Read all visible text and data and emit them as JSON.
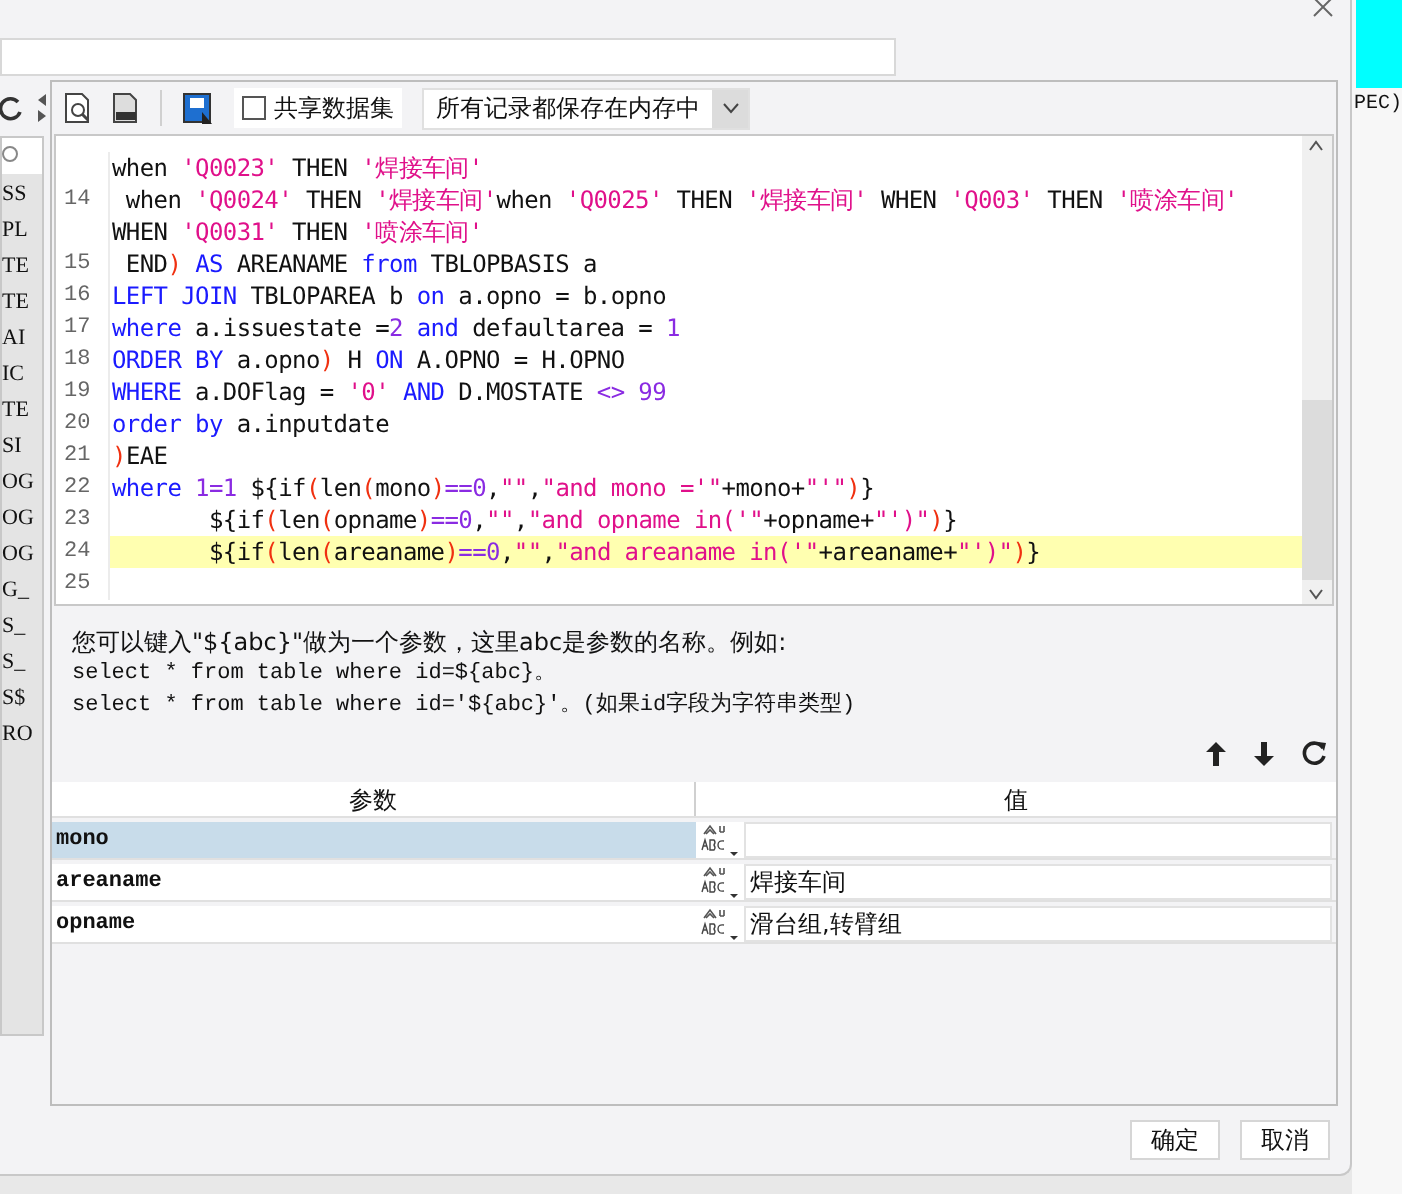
{
  "toolbar": {
    "share_checkbox": {
      "label": "共享数据集",
      "checked": false
    },
    "cache_dropdown": {
      "value": "所有记录都保存在内存中"
    }
  },
  "side_list": [
    "SS",
    "PL",
    "TE",
    "TE",
    "AI",
    "IC",
    "TE",
    "SI",
    "OG",
    "OG",
    "OG",
    "G_",
    "S_",
    "S_",
    "S$",
    "RO"
  ],
  "right_sheet": {
    "cell": "PEC)"
  },
  "editor": {
    "lines": [
      {
        "highlighted": false,
        "tokens": [
          {
            "kind": "plain",
            "text": "when "
          },
          {
            "kind": "str",
            "text": "'Q0023'"
          },
          {
            "kind": "plain",
            "text": " THEN "
          },
          {
            "kind": "str",
            "text": "'焊接车间'"
          }
        ]
      },
      {
        "number": "14",
        "highlighted": false,
        "tokens": [
          {
            "kind": "plain",
            "text": " when "
          },
          {
            "kind": "str",
            "text": "'Q0024'"
          },
          {
            "kind": "plain",
            "text": " THEN "
          },
          {
            "kind": "str",
            "text": "'焊接车间'"
          },
          {
            "kind": "plain",
            "text": "when "
          },
          {
            "kind": "str",
            "text": "'Q0025'"
          },
          {
            "kind": "plain",
            "text": " THEN "
          },
          {
            "kind": "str",
            "text": "'焊接车间'"
          },
          {
            "kind": "plain",
            "text": " WHEN "
          },
          {
            "kind": "str",
            "text": "'Q003'"
          },
          {
            "kind": "plain",
            "text": " THEN "
          },
          {
            "kind": "str",
            "text": "'喷涂车间'"
          }
        ]
      },
      {
        "highlighted": false,
        "tokens": [
          {
            "kind": "plain",
            "text": "WHEN "
          },
          {
            "kind": "str",
            "text": "'Q0031'"
          },
          {
            "kind": "plain",
            "text": " THEN "
          },
          {
            "kind": "str",
            "text": "'喷涂车间'"
          }
        ]
      },
      {
        "number": "15",
        "highlighted": false,
        "tokens": [
          {
            "kind": "plain",
            "text": " END"
          },
          {
            "kind": "paren",
            "text": ")"
          },
          {
            "kind": "kw",
            "text": " AS"
          },
          {
            "kind": "plain",
            "text": " AREANAME "
          },
          {
            "kind": "kw",
            "text": "from"
          },
          {
            "kind": "plain",
            "text": " TBLOPBASIS a"
          }
        ]
      },
      {
        "number": "16",
        "highlighted": false,
        "tokens": [
          {
            "kind": "kw",
            "text": "LEFT JOIN"
          },
          {
            "kind": "plain",
            "text": " TBLOPAREA b "
          },
          {
            "kind": "kw",
            "text": "on"
          },
          {
            "kind": "plain",
            "text": " a.opno = b.opno"
          }
        ]
      },
      {
        "number": "17",
        "highlighted": false,
        "tokens": [
          {
            "kind": "kw",
            "text": "where"
          },
          {
            "kind": "plain",
            "text": " a.issuestate ="
          },
          {
            "kind": "num",
            "text": "2"
          },
          {
            "kind": "kw",
            "text": " and"
          },
          {
            "kind": "plain",
            "text": " defaultarea = "
          },
          {
            "kind": "num",
            "text": "1"
          }
        ]
      },
      {
        "number": "18",
        "highlighted": false,
        "tokens": [
          {
            "kind": "kw",
            "text": "ORDER BY"
          },
          {
            "kind": "plain",
            "text": " a.opno"
          },
          {
            "kind": "paren",
            "text": ")"
          },
          {
            "kind": "plain",
            "text": " H "
          },
          {
            "kind": "kw",
            "text": "ON"
          },
          {
            "kind": "plain",
            "text": " A.OPNO = H.OPNO"
          }
        ]
      },
      {
        "number": "19",
        "highlighted": false,
        "tokens": [
          {
            "kind": "kw",
            "text": "WHERE"
          },
          {
            "kind": "plain",
            "text": " a.DOFlag = "
          },
          {
            "kind": "str",
            "text": "'0'"
          },
          {
            "kind": "kw",
            "text": " AND"
          },
          {
            "kind": "plain",
            "text": " D.MOSTATE "
          },
          {
            "kind": "num",
            "text": "<> 99"
          }
        ]
      },
      {
        "number": "20",
        "highlighted": false,
        "tokens": [
          {
            "kind": "kw",
            "text": "order by"
          },
          {
            "kind": "plain",
            "text": " a.inputdate"
          }
        ]
      },
      {
        "number": "21",
        "highlighted": false,
        "tokens": [
          {
            "kind": "paren",
            "text": ")"
          },
          {
            "kind": "plain",
            "text": "EAE"
          }
        ]
      },
      {
        "number": "22",
        "highlighted": false,
        "tokens": [
          {
            "kind": "kw",
            "text": "where"
          },
          {
            "kind": "num",
            "text": " 1=1"
          },
          {
            "kind": "plain",
            "text": " ${if"
          },
          {
            "kind": "paren",
            "text": "("
          },
          {
            "kind": "plain",
            "text": "len"
          },
          {
            "kind": "paren",
            "text": "("
          },
          {
            "kind": "plain",
            "text": "mono"
          },
          {
            "kind": "paren",
            "text": ")"
          },
          {
            "kind": "num",
            "text": "==0"
          },
          {
            "kind": "plain",
            "text": ","
          },
          {
            "kind": "str",
            "text": "\"\""
          },
          {
            "kind": "plain",
            "text": ","
          },
          {
            "kind": "str",
            "text": "\"and mono ='\""
          },
          {
            "kind": "plain",
            "text": "+mono+"
          },
          {
            "kind": "str",
            "text": "\"'\""
          },
          {
            "kind": "paren",
            "text": ")"
          },
          {
            "kind": "plain",
            "text": "}"
          }
        ]
      },
      {
        "number": "23",
        "highlighted": false,
        "tokens": [
          {
            "kind": "plain",
            "text": "       ${if"
          },
          {
            "kind": "paren",
            "text": "("
          },
          {
            "kind": "plain",
            "text": "len"
          },
          {
            "kind": "paren",
            "text": "("
          },
          {
            "kind": "plain",
            "text": "opname"
          },
          {
            "kind": "paren",
            "text": ")"
          },
          {
            "kind": "num",
            "text": "==0"
          },
          {
            "kind": "plain",
            "text": ","
          },
          {
            "kind": "str",
            "text": "\"\""
          },
          {
            "kind": "plain",
            "text": ","
          },
          {
            "kind": "str",
            "text": "\"and opname in('\""
          },
          {
            "kind": "plain",
            "text": "+opname+"
          },
          {
            "kind": "str",
            "text": "\"')\""
          },
          {
            "kind": "paren",
            "text": ")"
          },
          {
            "kind": "plain",
            "text": "}"
          }
        ]
      },
      {
        "number": "24",
        "highlighted": true,
        "tokens": [
          {
            "kind": "plain",
            "text": "       ${if"
          },
          {
            "kind": "paren",
            "text": "("
          },
          {
            "kind": "plain",
            "text": "len"
          },
          {
            "kind": "paren",
            "text": "("
          },
          {
            "kind": "plain",
            "text": "areaname"
          },
          {
            "kind": "paren",
            "text": ")"
          },
          {
            "kind": "num",
            "text": "==0"
          },
          {
            "kind": "plain",
            "text": ","
          },
          {
            "kind": "str",
            "text": "\"\""
          },
          {
            "kind": "plain",
            "text": ","
          },
          {
            "kind": "str",
            "text": "\"and areaname in('\""
          },
          {
            "kind": "plain",
            "text": "+areaname+"
          },
          {
            "kind": "str",
            "text": "\"')\""
          },
          {
            "kind": "paren",
            "text": ")"
          },
          {
            "kind": "plain",
            "text": "}"
          }
        ]
      },
      {
        "number": "25",
        "highlighted": false
      }
    ]
  },
  "help": {
    "intro": "您可以键入\"${abc}\"做为一个参数，这里abc是参数的名称。例如:",
    "example_1": "select * from table where id=${abc}。",
    "example_2": "select * from table where id='${abc}'。(如果id字段为字符串类型)"
  },
  "params": {
    "columns": [
      "参数",
      "值"
    ],
    "rows": [
      {
        "name": "mono",
        "value": "",
        "selected": true
      },
      {
        "name": "areaname",
        "value": "焊接车间",
        "selected": false
      },
      {
        "name": "opname",
        "value": "滑台组,转臂组",
        "selected": false
      }
    ]
  },
  "buttons": [
    "确定",
    "取消"
  ]
}
